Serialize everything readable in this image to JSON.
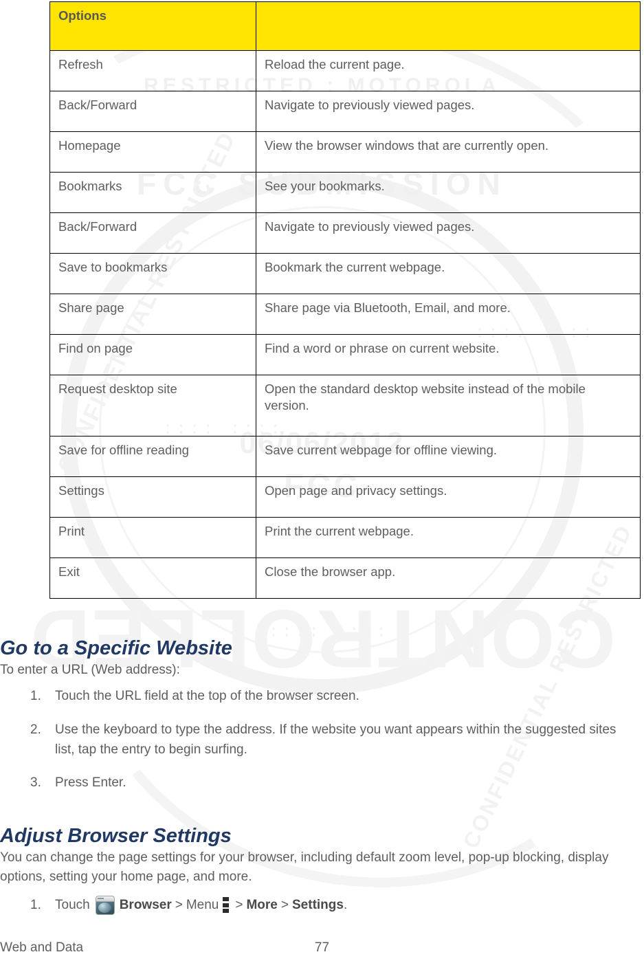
{
  "document": {
    "footer": {
      "section_label": "Web and Data",
      "page_number": "77"
    }
  },
  "watermark": {
    "ring_top_text": "RESTRICTED : MOTOROLA",
    "ring_mid_text": "FCC SUBMISSION",
    "date": "06/06/2012",
    "agency": "FCC",
    "big_text": "CONTROLLED",
    "diagonal_left": "CONFIDENTIAL RESTRICTED",
    "diagonal_right": "CONFIDENTIAL RESTRICTED",
    "dots": ":::: ::::"
  },
  "options_table": {
    "columns": [
      "Options",
      ""
    ],
    "rows": [
      {
        "option": "Refresh",
        "description": "Reload the current page."
      },
      {
        "option": "Back/Forward",
        "description": "Navigate to previously viewed pages."
      },
      {
        "option": "Homepage",
        "description": "View the browser windows that are currently open."
      },
      {
        "option": "Bookmarks",
        "description": "See your bookmarks."
      },
      {
        "option": "Back/Forward",
        "description": "Navigate to previously viewed pages."
      },
      {
        "option": "Save to bookmarks",
        "description": "Bookmark the current webpage."
      },
      {
        "option": "Share page",
        "description": "Share page via Bluetooth, Email, and more."
      },
      {
        "option": "Find on page",
        "description": "Find a word or phrase on current website."
      },
      {
        "option": "Request desktop site",
        "description": "Open the standard desktop website instead of the mobile version."
      },
      {
        "option": "Save for offline reading",
        "description": "Save current webpage for offline viewing."
      },
      {
        "option": "Settings",
        "description": "Open page and privacy settings."
      },
      {
        "option": "Print",
        "description": "Print the current webpage."
      },
      {
        "option": "Exit",
        "description": "Close the browser app."
      }
    ]
  },
  "sections": {
    "goto_website": {
      "heading": "Go to a Specific Website",
      "intro": "To enter a URL (Web address):",
      "steps": [
        {
          "num": "1.",
          "text": "Touch the URL field at the top of the browser screen."
        },
        {
          "num": "2.",
          "text": "Use the keyboard to type the address. If the website you want appears within the suggested sites list, tap the entry to begin surfing."
        },
        {
          "num": "3.",
          "text": "Press Enter."
        }
      ]
    },
    "adjust_browser": {
      "heading": "Adjust Browser Settings",
      "intro": "You can change the page settings for your browser, including default zoom level, pop-up blocking, display options, setting your home page, and more.",
      "step": {
        "num": "1.",
        "touch_label": "Touch",
        "browser_label": "Browser",
        "sep1": ">",
        "menu_label": "Menu",
        "sep2": ">",
        "more_label": "More",
        "sep3": ">",
        "settings_label": "Settings",
        "period": "."
      }
    }
  },
  "colors": {
    "table_header_bg": "#ffe400",
    "heading_blue": "#1f3864",
    "body_text": "#5e5e5e",
    "border": "#000000"
  }
}
